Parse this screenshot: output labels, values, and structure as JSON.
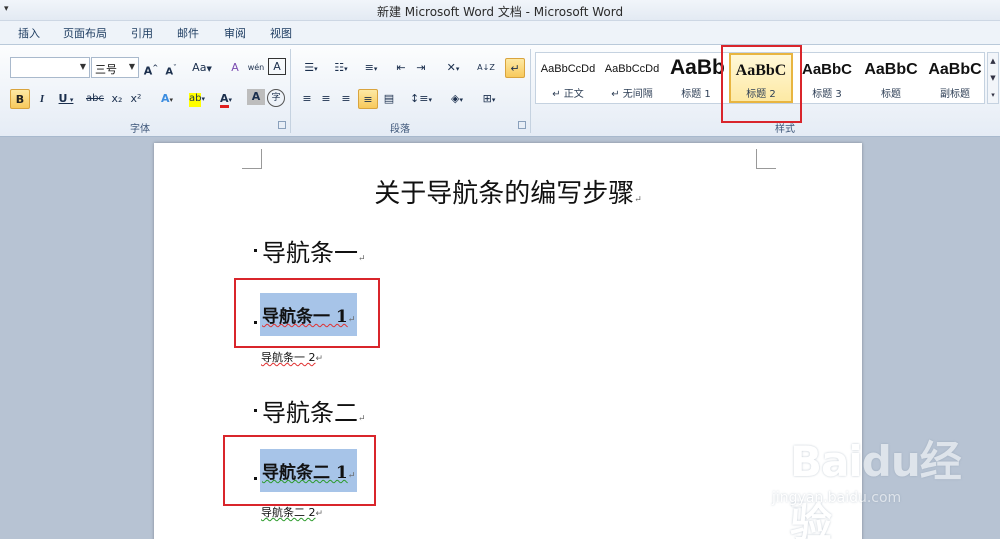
{
  "window": {
    "title": "新建 Microsoft Word 文档 - Microsoft Word",
    "qat_glyph": "▾"
  },
  "tabs": [
    "插入",
    "页面布局",
    "引用",
    "邮件",
    "审阅",
    "视图"
  ],
  "font_group": {
    "font_name": "",
    "font_size": "三号",
    "grow": "A",
    "shrink": "A",
    "case": "Aa",
    "clear_format": "A",
    "phonetic": "wén",
    "border_char": "A",
    "bold": "B",
    "italic": "I",
    "underline": "U",
    "strike": "abc",
    "subscript": "x₂",
    "superscript": "x²",
    "text_effect": "A",
    "highlight": "ab",
    "font_color": "A",
    "char_shading": "A",
    "enclose": "字",
    "label": "字体"
  },
  "paragraph_group": {
    "label": "段落",
    "sort": "A↓Z"
  },
  "styles_group": {
    "label": "样式",
    "items": [
      {
        "sample": "AaBbCcDd",
        "label": "↵ 正文"
      },
      {
        "sample": "AaBbCcDd",
        "label": "↵ 无间隔"
      },
      {
        "sample": "AaBb",
        "label": "标题 1"
      },
      {
        "sample": "AaBbC",
        "label": "标题 2"
      },
      {
        "sample": "AaBbC",
        "label": "标题 3"
      },
      {
        "sample": "AaBbC",
        "label": "标题"
      },
      {
        "sample": "AaBbC",
        "label": "副标题"
      }
    ]
  },
  "document": {
    "title": "关于导航条的编写步骤",
    "heading1_a": "导航条一",
    "heading2_a": "导航条一 1",
    "body_a": "导航条一 2",
    "heading1_b": "导航条二",
    "heading2_b": "导航条二 1",
    "body_b": "导航条二 2",
    "para_mark": "↵"
  },
  "watermark": {
    "brand": "Baidu经验",
    "url": "jingyan.baidu.com"
  },
  "colors": {
    "selection": "#a7c4e8",
    "annotation": "#d9252b",
    "active_style": "#fde9a4"
  }
}
